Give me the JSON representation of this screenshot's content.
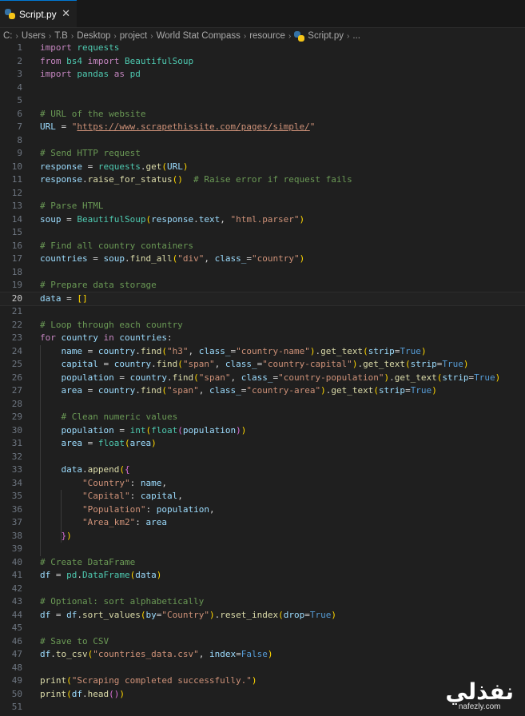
{
  "tab": {
    "label": "Script.py",
    "close": "✕"
  },
  "breadcrumb": {
    "items": [
      "C:",
      "Users",
      "T.B",
      "Desktop",
      "project",
      "World Stat Compass",
      "resource"
    ],
    "file": "Script.py",
    "more": "..."
  },
  "editor": {
    "current_line": 20,
    "lines": [
      [
        [
          "kw",
          "import"
        ],
        [
          "op",
          " "
        ],
        [
          "mod",
          "requests"
        ]
      ],
      [
        [
          "kw",
          "from"
        ],
        [
          "op",
          " "
        ],
        [
          "mod",
          "bs4"
        ],
        [
          "op",
          " "
        ],
        [
          "kw",
          "import"
        ],
        [
          "op",
          " "
        ],
        [
          "mod",
          "BeautifulSoup"
        ]
      ],
      [
        [
          "kw",
          "import"
        ],
        [
          "op",
          " "
        ],
        [
          "mod",
          "pandas"
        ],
        [
          "op",
          " "
        ],
        [
          "kw",
          "as"
        ],
        [
          "op",
          " "
        ],
        [
          "mod",
          "pd"
        ]
      ],
      [],
      [],
      [
        [
          "cm",
          "# URL of the website"
        ]
      ],
      [
        [
          "id",
          "URL"
        ],
        [
          "op",
          " = "
        ],
        [
          "str",
          "\""
        ],
        [
          "url",
          "https://www.scrapethissite.com/pages/simple/"
        ],
        [
          "str",
          "\""
        ]
      ],
      [],
      [
        [
          "cm",
          "# Send HTTP request"
        ]
      ],
      [
        [
          "id",
          "response"
        ],
        [
          "op",
          " = "
        ],
        [
          "mod",
          "requests"
        ],
        [
          "op",
          "."
        ],
        [
          "fn",
          "get"
        ],
        [
          "br1",
          "("
        ],
        [
          "id",
          "URL"
        ],
        [
          "br1",
          ")"
        ]
      ],
      [
        [
          "id",
          "response"
        ],
        [
          "op",
          "."
        ],
        [
          "fn",
          "raise_for_status"
        ],
        [
          "br1",
          "()"
        ],
        [
          "op",
          "  "
        ],
        [
          "cm",
          "# Raise error if request fails"
        ]
      ],
      [],
      [
        [
          "cm",
          "# Parse HTML"
        ]
      ],
      [
        [
          "id",
          "soup"
        ],
        [
          "op",
          " = "
        ],
        [
          "mod",
          "BeautifulSoup"
        ],
        [
          "br1",
          "("
        ],
        [
          "id",
          "response"
        ],
        [
          "op",
          "."
        ],
        [
          "id",
          "text"
        ],
        [
          "op",
          ", "
        ],
        [
          "str",
          "\"html.parser\""
        ],
        [
          "br1",
          ")"
        ]
      ],
      [],
      [
        [
          "cm",
          "# Find all country containers"
        ]
      ],
      [
        [
          "id",
          "countries"
        ],
        [
          "op",
          " = "
        ],
        [
          "id",
          "soup"
        ],
        [
          "op",
          "."
        ],
        [
          "fn",
          "find_all"
        ],
        [
          "br1",
          "("
        ],
        [
          "str",
          "\"div\""
        ],
        [
          "op",
          ", "
        ],
        [
          "id",
          "class_"
        ],
        [
          "op",
          "="
        ],
        [
          "str",
          "\"country\""
        ],
        [
          "br1",
          ")"
        ]
      ],
      [],
      [
        [
          "cm",
          "# Prepare data storage"
        ]
      ],
      [
        [
          "id",
          "data"
        ],
        [
          "op",
          " = "
        ],
        [
          "br1",
          "[]"
        ]
      ],
      [],
      [
        [
          "cm",
          "# Loop through each country"
        ]
      ],
      [
        [
          "kw",
          "for"
        ],
        [
          "op",
          " "
        ],
        [
          "id",
          "country"
        ],
        [
          "op",
          " "
        ],
        [
          "kw",
          "in"
        ],
        [
          "op",
          " "
        ],
        [
          "id",
          "countries"
        ],
        [
          "op",
          ":"
        ]
      ],
      [
        [
          "op",
          "    "
        ],
        [
          "id",
          "name"
        ],
        [
          "op",
          " = "
        ],
        [
          "id",
          "country"
        ],
        [
          "op",
          "."
        ],
        [
          "fn",
          "find"
        ],
        [
          "br1",
          "("
        ],
        [
          "str",
          "\"h3\""
        ],
        [
          "op",
          ", "
        ],
        [
          "id",
          "class_"
        ],
        [
          "op",
          "="
        ],
        [
          "str",
          "\"country-name\""
        ],
        [
          "br1",
          ")"
        ],
        [
          "op",
          "."
        ],
        [
          "fn",
          "get_text"
        ],
        [
          "br1",
          "("
        ],
        [
          "id",
          "strip"
        ],
        [
          "op",
          "="
        ],
        [
          "bool",
          "True"
        ],
        [
          "br1",
          ")"
        ]
      ],
      [
        [
          "op",
          "    "
        ],
        [
          "id",
          "capital"
        ],
        [
          "op",
          " = "
        ],
        [
          "id",
          "country"
        ],
        [
          "op",
          "."
        ],
        [
          "fn",
          "find"
        ],
        [
          "br1",
          "("
        ],
        [
          "str",
          "\"span\""
        ],
        [
          "op",
          ", "
        ],
        [
          "id",
          "class_"
        ],
        [
          "op",
          "="
        ],
        [
          "str",
          "\"country-capital\""
        ],
        [
          "br1",
          ")"
        ],
        [
          "op",
          "."
        ],
        [
          "fn",
          "get_text"
        ],
        [
          "br1",
          "("
        ],
        [
          "id",
          "strip"
        ],
        [
          "op",
          "="
        ],
        [
          "bool",
          "True"
        ],
        [
          "br1",
          ")"
        ]
      ],
      [
        [
          "op",
          "    "
        ],
        [
          "id",
          "population"
        ],
        [
          "op",
          " = "
        ],
        [
          "id",
          "country"
        ],
        [
          "op",
          "."
        ],
        [
          "fn",
          "find"
        ],
        [
          "br1",
          "("
        ],
        [
          "str",
          "\"span\""
        ],
        [
          "op",
          ", "
        ],
        [
          "id",
          "class_"
        ],
        [
          "op",
          "="
        ],
        [
          "str",
          "\"country-population\""
        ],
        [
          "br1",
          ")"
        ],
        [
          "op",
          "."
        ],
        [
          "fn",
          "get_text"
        ],
        [
          "br1",
          "("
        ],
        [
          "id",
          "strip"
        ],
        [
          "op",
          "="
        ],
        [
          "bool",
          "True"
        ],
        [
          "br1",
          ")"
        ]
      ],
      [
        [
          "op",
          "    "
        ],
        [
          "id",
          "area"
        ],
        [
          "op",
          " = "
        ],
        [
          "id",
          "country"
        ],
        [
          "op",
          "."
        ],
        [
          "fn",
          "find"
        ],
        [
          "br1",
          "("
        ],
        [
          "str",
          "\"span\""
        ],
        [
          "op",
          ", "
        ],
        [
          "id",
          "class_"
        ],
        [
          "op",
          "="
        ],
        [
          "str",
          "\"country-area\""
        ],
        [
          "br1",
          ")"
        ],
        [
          "op",
          "."
        ],
        [
          "fn",
          "get_text"
        ],
        [
          "br1",
          "("
        ],
        [
          "id",
          "strip"
        ],
        [
          "op",
          "="
        ],
        [
          "bool",
          "True"
        ],
        [
          "br1",
          ")"
        ]
      ],
      [],
      [
        [
          "op",
          "    "
        ],
        [
          "cm",
          "# Clean numeric values"
        ]
      ],
      [
        [
          "op",
          "    "
        ],
        [
          "id",
          "population"
        ],
        [
          "op",
          " = "
        ],
        [
          "mod",
          "int"
        ],
        [
          "br1",
          "("
        ],
        [
          "mod",
          "float"
        ],
        [
          "br2",
          "("
        ],
        [
          "id",
          "population"
        ],
        [
          "br2",
          ")"
        ],
        [
          "br1",
          ")"
        ]
      ],
      [
        [
          "op",
          "    "
        ],
        [
          "id",
          "area"
        ],
        [
          "op",
          " = "
        ],
        [
          "mod",
          "float"
        ],
        [
          "br1",
          "("
        ],
        [
          "id",
          "area"
        ],
        [
          "br1",
          ")"
        ]
      ],
      [],
      [
        [
          "op",
          "    "
        ],
        [
          "id",
          "data"
        ],
        [
          "op",
          "."
        ],
        [
          "fn",
          "append"
        ],
        [
          "br1",
          "("
        ],
        [
          "br2",
          "{"
        ]
      ],
      [
        [
          "op",
          "        "
        ],
        [
          "str",
          "\"Country\""
        ],
        [
          "op",
          ": "
        ],
        [
          "id",
          "name"
        ],
        [
          "op",
          ","
        ]
      ],
      [
        [
          "op",
          "        "
        ],
        [
          "str",
          "\"Capital\""
        ],
        [
          "op",
          ": "
        ],
        [
          "id",
          "capital"
        ],
        [
          "op",
          ","
        ]
      ],
      [
        [
          "op",
          "        "
        ],
        [
          "str",
          "\"Population\""
        ],
        [
          "op",
          ": "
        ],
        [
          "id",
          "population"
        ],
        [
          "op",
          ","
        ]
      ],
      [
        [
          "op",
          "        "
        ],
        [
          "str",
          "\"Area_km2\""
        ],
        [
          "op",
          ": "
        ],
        [
          "id",
          "area"
        ]
      ],
      [
        [
          "op",
          "    "
        ],
        [
          "br2",
          "}"
        ],
        [
          "br1",
          ")"
        ]
      ],
      [],
      [
        [
          "cm",
          "# Create DataFrame"
        ]
      ],
      [
        [
          "id",
          "df"
        ],
        [
          "op",
          " = "
        ],
        [
          "mod",
          "pd"
        ],
        [
          "op",
          "."
        ],
        [
          "mod",
          "DataFrame"
        ],
        [
          "br1",
          "("
        ],
        [
          "id",
          "data"
        ],
        [
          "br1",
          ")"
        ]
      ],
      [],
      [
        [
          "cm",
          "# Optional: sort alphabetically"
        ]
      ],
      [
        [
          "id",
          "df"
        ],
        [
          "op",
          " = "
        ],
        [
          "id",
          "df"
        ],
        [
          "op",
          "."
        ],
        [
          "fn",
          "sort_values"
        ],
        [
          "br1",
          "("
        ],
        [
          "id",
          "by"
        ],
        [
          "op",
          "="
        ],
        [
          "str",
          "\"Country\""
        ],
        [
          "br1",
          ")"
        ],
        [
          "op",
          "."
        ],
        [
          "fn",
          "reset_index"
        ],
        [
          "br1",
          "("
        ],
        [
          "id",
          "drop"
        ],
        [
          "op",
          "="
        ],
        [
          "bool",
          "True"
        ],
        [
          "br1",
          ")"
        ]
      ],
      [],
      [
        [
          "cm",
          "# Save to CSV"
        ]
      ],
      [
        [
          "id",
          "df"
        ],
        [
          "op",
          "."
        ],
        [
          "fn",
          "to_csv"
        ],
        [
          "br1",
          "("
        ],
        [
          "str",
          "\"countries_data.csv\""
        ],
        [
          "op",
          ", "
        ],
        [
          "id",
          "index"
        ],
        [
          "op",
          "="
        ],
        [
          "bool",
          "False"
        ],
        [
          "br1",
          ")"
        ]
      ],
      [],
      [
        [
          "fn",
          "print"
        ],
        [
          "br1",
          "("
        ],
        [
          "str",
          "\"Scraping completed successfully.\""
        ],
        [
          "br1",
          ")"
        ]
      ],
      [
        [
          "fn",
          "print"
        ],
        [
          "br1",
          "("
        ],
        [
          "id",
          "df"
        ],
        [
          "op",
          "."
        ],
        [
          "fn",
          "head"
        ],
        [
          "br2",
          "()"
        ],
        [
          "br1",
          ")"
        ]
      ],
      []
    ]
  },
  "watermark": {
    "logo": "نفذلي",
    "site": "nafezly.com"
  }
}
